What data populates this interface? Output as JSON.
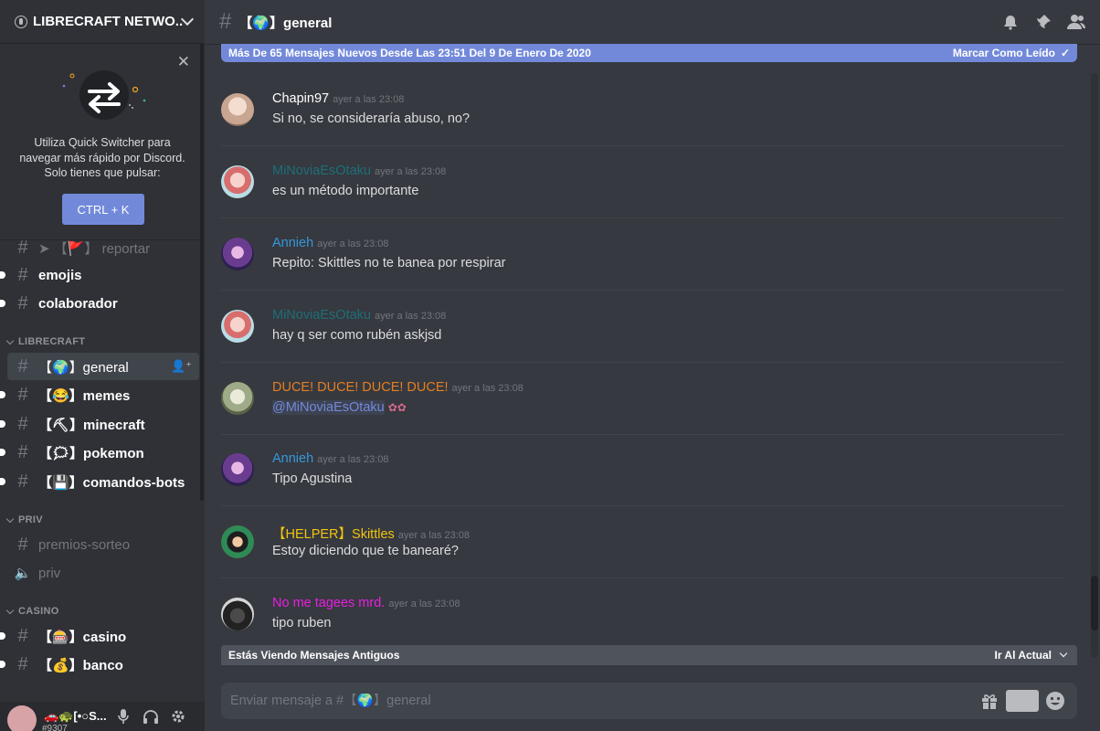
{
  "server": {
    "name": "LIBRECRAFT NETWO..."
  },
  "quick_switcher": {
    "text_line1": "Utiliza Quick Switcher para",
    "text_line2": "navegar más rápido por Discord.",
    "text_line3": "Solo tienes que pulsar:",
    "button": "CTRL + K"
  },
  "channels_top": [
    {
      "label": "reportar",
      "prefix": "➤ 【🚩】"
    },
    {
      "label": "emojis"
    },
    {
      "label": "colaborador"
    }
  ],
  "categories": {
    "librecraft": "LIBRECRAFT",
    "priv": "PRIV",
    "casino": "CASINO"
  },
  "librecraft_channels": [
    {
      "label": "【🌍】general"
    },
    {
      "label": "【😂】memes"
    },
    {
      "label": "【⛏】minecraft"
    },
    {
      "label": "【🗯】pokemon"
    },
    {
      "label": "【💾】comandos-bots"
    }
  ],
  "priv_channels": [
    {
      "label": "premios-sorteo"
    },
    {
      "label": "priv"
    }
  ],
  "casino_channels": [
    {
      "label": "【🎰】casino"
    },
    {
      "label": "【💰】banco"
    }
  ],
  "user": {
    "name": "🚗🐢[•○S...",
    "tag": "#9307"
  },
  "header": {
    "channel_name": "【🌍】general"
  },
  "new_messages_bar": {
    "text": "Más De 65 Mensajes Nuevos Desde Las 23:51 Del 9 De Enero De 2020",
    "mark_read": "Marcar Como Leído"
  },
  "messages": [
    {
      "author": "Chapin97",
      "time": "ayer a las 23:08",
      "text": "Si no, se consideraría abuso, no?",
      "color": "#ffffff"
    },
    {
      "author": "MiNoviaEsOtaku",
      "time": "ayer a las 23:08",
      "text": "es un método importante",
      "color": "#1d6f7a"
    },
    {
      "author": "Annieh",
      "time": "ayer a las 23:08",
      "text": "Repito: Skittles no te banea por respirar",
      "color": "#3498db"
    },
    {
      "author": "MiNoviaEsOtaku",
      "time": "ayer a las 23:08",
      "text": "hay q ser como rubén askjsd",
      "color": "#1d6f7a"
    },
    {
      "author": "DUCE! DUCE! DUCE! DUCE!",
      "time": "ayer a las 23:08",
      "text": "",
      "mention": "@MiNoviaEsOtaku",
      "color": "#e67e22"
    },
    {
      "author": "Annieh",
      "time": "ayer a las 23:08",
      "text": "Tipo Agustina",
      "color": "#3498db"
    },
    {
      "author": "【HELPER】Skittles",
      "time": "ayer a las 23:08",
      "text": "Estoy diciendo que te banearé?",
      "color": "#f1c40f"
    },
    {
      "author": "No me tagees mrd.",
      "time": "ayer a las 23:08",
      "text": "tipo ruben",
      "color": "#e91ee3"
    }
  ],
  "old_messages_bar": {
    "text": "Estás Viendo Mensajes Antiguos",
    "jump": "Ir Al Actual"
  },
  "composer": {
    "placeholder": "Enviar mensaje a #【🌍】general"
  },
  "icons": {
    "bell": "bell-icon",
    "pin": "pin-icon",
    "members": "members-icon",
    "gift": "gift-icon",
    "gif": "GIF",
    "emoji": "emoji-icon",
    "mic": "microphone-icon",
    "headphones": "headphones-icon",
    "settings": "gear-icon"
  }
}
